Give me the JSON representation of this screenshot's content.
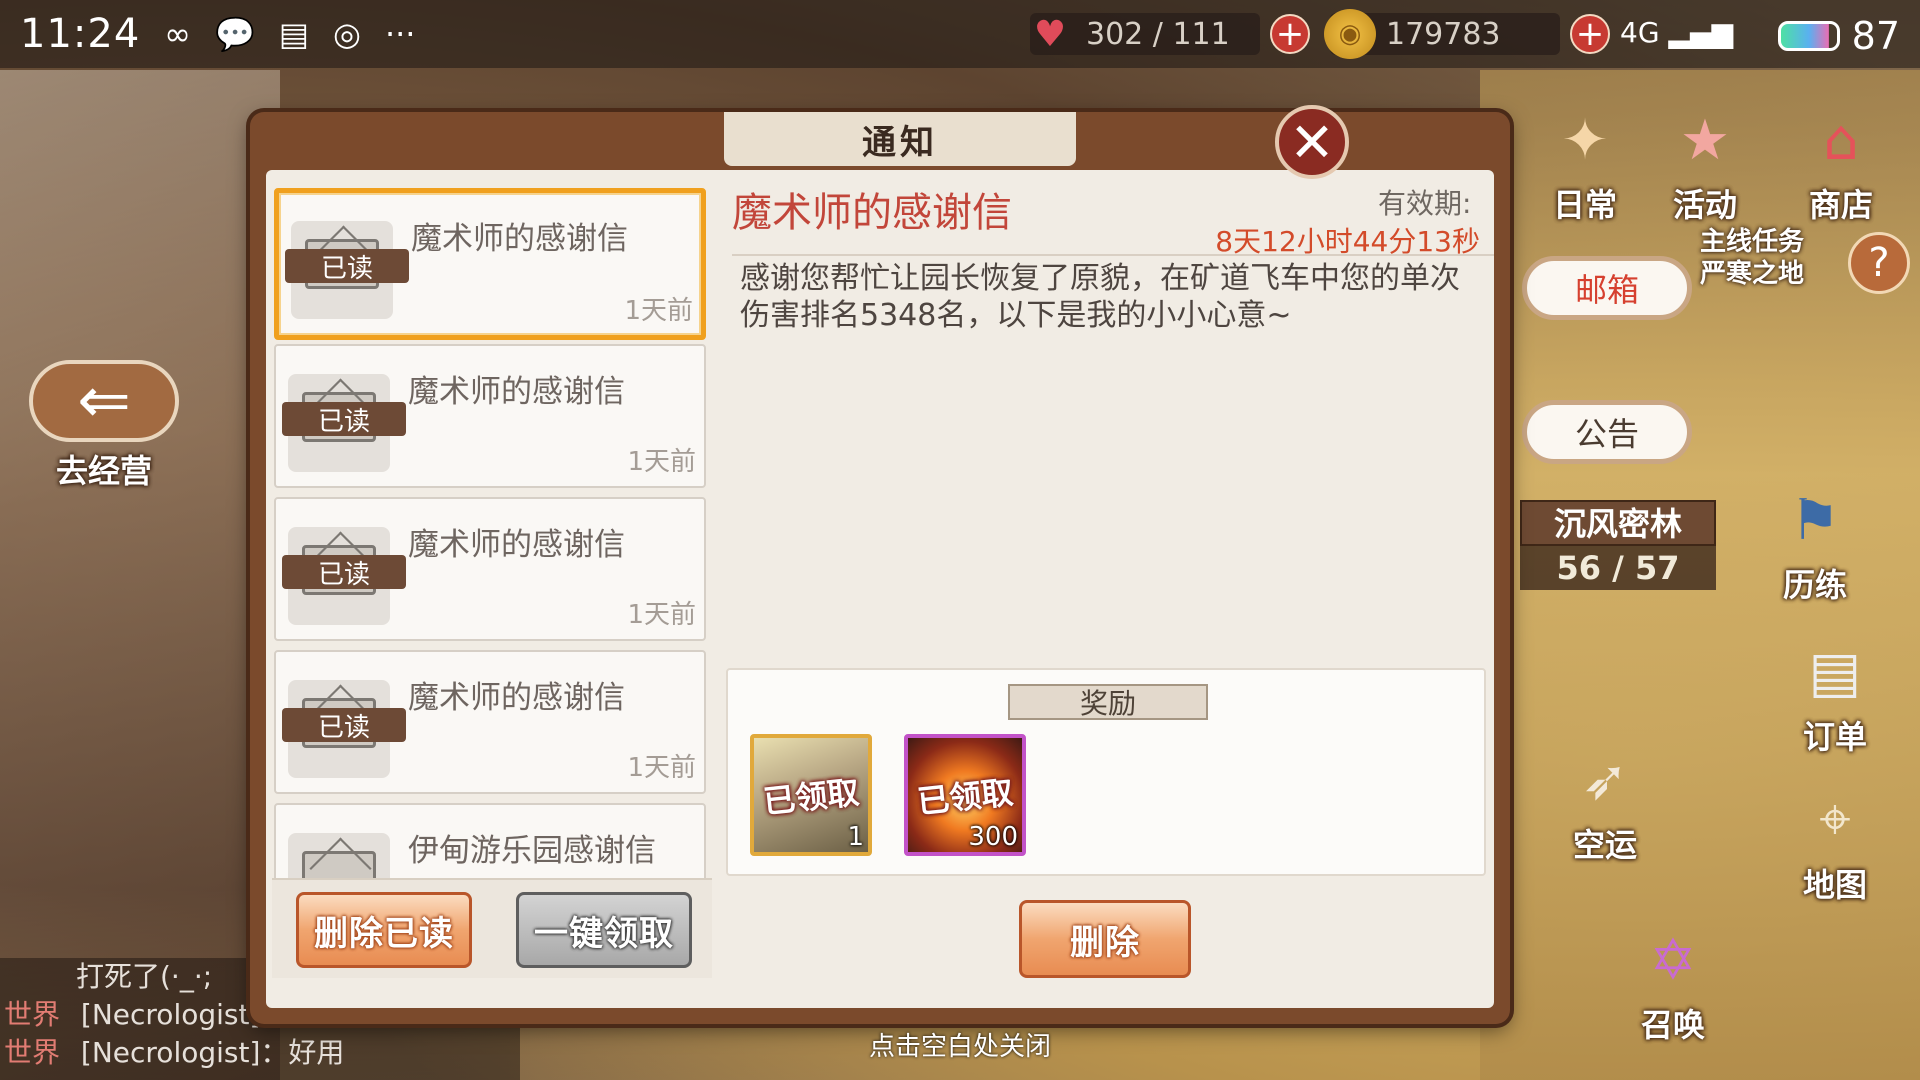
{
  "status_bar": {
    "time": "11:24",
    "icons": [
      "infinity-icon",
      "chat-bubble-icon",
      "receipt-icon",
      "weibo-icon",
      "more-dots-icon"
    ],
    "battery": "87",
    "signal": "4G"
  },
  "resources": {
    "hp": "302 / 111",
    "gold": "179783"
  },
  "dialog": {
    "title": "通知",
    "close_hint": "点击空白处关闭"
  },
  "mail_list": [
    {
      "title": "魔术师的感谢信",
      "status": "已读",
      "time": "1天前",
      "selected": true
    },
    {
      "title": "魔术师的感谢信",
      "status": "已读",
      "time": "1天前",
      "selected": false
    },
    {
      "title": "魔术师的感谢信",
      "status": "已读",
      "time": "1天前",
      "selected": false
    },
    {
      "title": "魔术师的感谢信",
      "status": "已读",
      "time": "1天前",
      "selected": false
    },
    {
      "title": "伊甸游乐园感谢信",
      "status": "",
      "time": "",
      "selected": false
    }
  ],
  "list_buttons": {
    "delete_read": "删除已读",
    "claim_all": "一键领取"
  },
  "detail": {
    "title": "魔术师的感谢信",
    "expiry_label": "有效期:",
    "expiry_value": "8天12小时44分13秒",
    "body": "感谢您帮忙让园长恢复了原貌，在矿道飞车中您的单次伤害排名5348名，以下是我的小小心意~",
    "reward_header": "奖励",
    "rewards": [
      {
        "status": "已领取",
        "qty": "1",
        "kind": "character-card"
      },
      {
        "status": "已领取",
        "qty": "300",
        "kind": "fire-crystal"
      }
    ],
    "delete_button": "删除"
  },
  "left_nav": {
    "go_business": "去经营"
  },
  "right_menu": {
    "daily": "日常",
    "activity": "活动",
    "shop": "商店",
    "mailbox": "邮箱",
    "announcement": "公告",
    "main_quest": "主线任务",
    "quest_name": "严寒之地",
    "stage_name": "沉风密林",
    "stage_progress": "56 / 57",
    "training": "历练",
    "orders": "订单",
    "air_transport": "空运",
    "map": "地图",
    "summon": "召唤"
  },
  "chat": [
    {
      "channel": "",
      "text": "打死了(·_·;"
    },
    {
      "channel": "世界",
      "text": "[Necrologist]：求霸王餐"
    },
    {
      "channel": "世界",
      "text": "[Necrologist]：好用"
    }
  ]
}
